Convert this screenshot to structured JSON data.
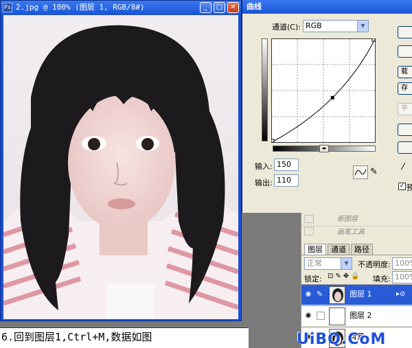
{
  "image_window": {
    "title": "2.jpg @ 100% (图层 1, RGB/8#)",
    "ps_icon": "Ps",
    "minimize": "_",
    "maximize": "□",
    "close": "✕"
  },
  "caption": "6.回到图层1,Ctrl+M,数据如图",
  "curves": {
    "title": "曲线",
    "channel_label": "通道(C):",
    "channel_value": "RGB",
    "input_label": "输入:",
    "input_value": "150",
    "output_label": "输出:",
    "output_value": "110",
    "buttons": [
      "",
      "",
      "载",
      "存",
      "平",
      "",
      ""
    ],
    "preview_label": "预",
    "input_level": 150,
    "output_level": 110
  },
  "history": {
    "items": [
      "新图层",
      "画笔工具"
    ]
  },
  "layers": {
    "tabs": [
      "图层",
      "通道",
      "路径"
    ],
    "blend_mode": "正常",
    "opacity_label": "不透明度:",
    "opacity_value": "100%",
    "lock_label": "锁定:",
    "fill_label": "填充:",
    "fill_value": "100%",
    "rows": [
      {
        "name": "图层 1",
        "selected": true
      },
      {
        "name": "图层 2",
        "selected": false
      },
      {
        "name": "背景",
        "selected": false
      }
    ]
  },
  "watermark": "UiBQ.CoM"
}
